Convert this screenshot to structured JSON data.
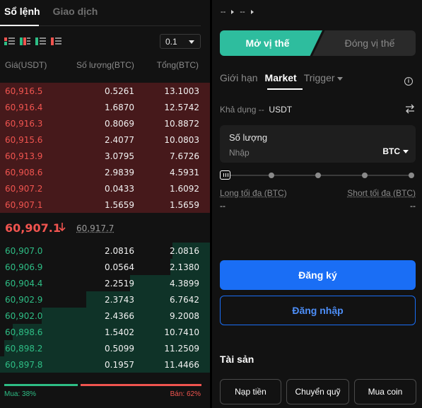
{
  "orderbook": {
    "tabs": [
      {
        "label": "Sổ lệnh",
        "active": true
      },
      {
        "label": "Giao dịch",
        "active": false
      }
    ],
    "depth_value": "0.1",
    "headers": {
      "price": "Giá(USDT)",
      "qty": "Số lượng(BTC)",
      "total": "Tổng(BTC)"
    },
    "asks": [
      {
        "price": "60,916.5",
        "qty": "0.5261",
        "total": "13.1003",
        "depth": 1.0
      },
      {
        "price": "60,916.4",
        "qty": "1.6870",
        "total": "12.5742",
        "depth": 1.0
      },
      {
        "price": "60,916.3",
        "qty": "0.8069",
        "total": "10.8872",
        "depth": 1.0
      },
      {
        "price": "60,915.6",
        "qty": "2.4077",
        "total": "10.0803",
        "depth": 1.0
      },
      {
        "price": "60,913.9",
        "qty": "3.0795",
        "total": "7.6726",
        "depth": 1.0
      },
      {
        "price": "60,908.6",
        "qty": "2.9839",
        "total": "4.5931",
        "depth": 1.0
      },
      {
        "price": "60,907.2",
        "qty": "0.0433",
        "total": "1.6092",
        "depth": 1.0
      },
      {
        "price": "60,907.1",
        "qty": "1.5659",
        "total": "1.5659",
        "depth": 1.0
      }
    ],
    "last_price": "60,907.1",
    "mark_price": "60,917.7",
    "bids": [
      {
        "price": "60,907.0",
        "qty": "2.0816",
        "total": "2.0816",
        "depth": 0.18
      },
      {
        "price": "60,906.9",
        "qty": "0.0564",
        "total": "2.1380",
        "depth": 0.19
      },
      {
        "price": "60,904.4",
        "qty": "2.2519",
        "total": "4.3899",
        "depth": 0.38
      },
      {
        "price": "60,902.9",
        "qty": "2.3743",
        "total": "6.7642",
        "depth": 0.59
      },
      {
        "price": "60,902.0",
        "qty": "2.4366",
        "total": "9.2008",
        "depth": 0.8
      },
      {
        "price": "60,898.6",
        "qty": "1.5402",
        "total": "10.7410",
        "depth": 0.94
      },
      {
        "price": "60,898.2",
        "qty": "0.5099",
        "total": "11.2509",
        "depth": 0.98
      },
      {
        "price": "60,897.8",
        "qty": "0.1957",
        "total": "11.4466",
        "depth": 1.0
      }
    ],
    "buy_ratio_label": "Mua: 38%",
    "sell_ratio_label": "Bán: 62%",
    "buy_ratio": 0.38,
    "sell_ratio": 0.62,
    "colors": {
      "ask": "#f0544f",
      "bid": "#2ebd85"
    }
  },
  "trade": {
    "crumbs": [
      "--",
      "--"
    ],
    "open_label": "Mở vị thế",
    "close_label": "Đóng vị thế",
    "order_tabs": [
      {
        "label": "Giới hạn",
        "active": false
      },
      {
        "label": "Market",
        "active": true
      },
      {
        "label": "Trigger",
        "active": false
      }
    ],
    "available_label": "Khả dụng",
    "available_value": "--",
    "available_unit": "USDT",
    "qty_label": "Số lượng",
    "qty_placeholder": "Nhập",
    "qty_unit": "BTC",
    "slider_value": 0,
    "long_max_label": "Long tối đa (BTC)",
    "long_max_value": "--",
    "short_max_label": "Short tối đa (BTC)",
    "short_max_value": "--",
    "register_label": "Đăng ký",
    "login_label": "Đăng nhập",
    "assets_title": "Tài sản",
    "asset_buttons": [
      "Nạp tiền",
      "Chuyển quỹ",
      "Mua coin"
    ],
    "colors": {
      "accent": "#2ebd9e",
      "primary": "#1a6ef5"
    }
  }
}
